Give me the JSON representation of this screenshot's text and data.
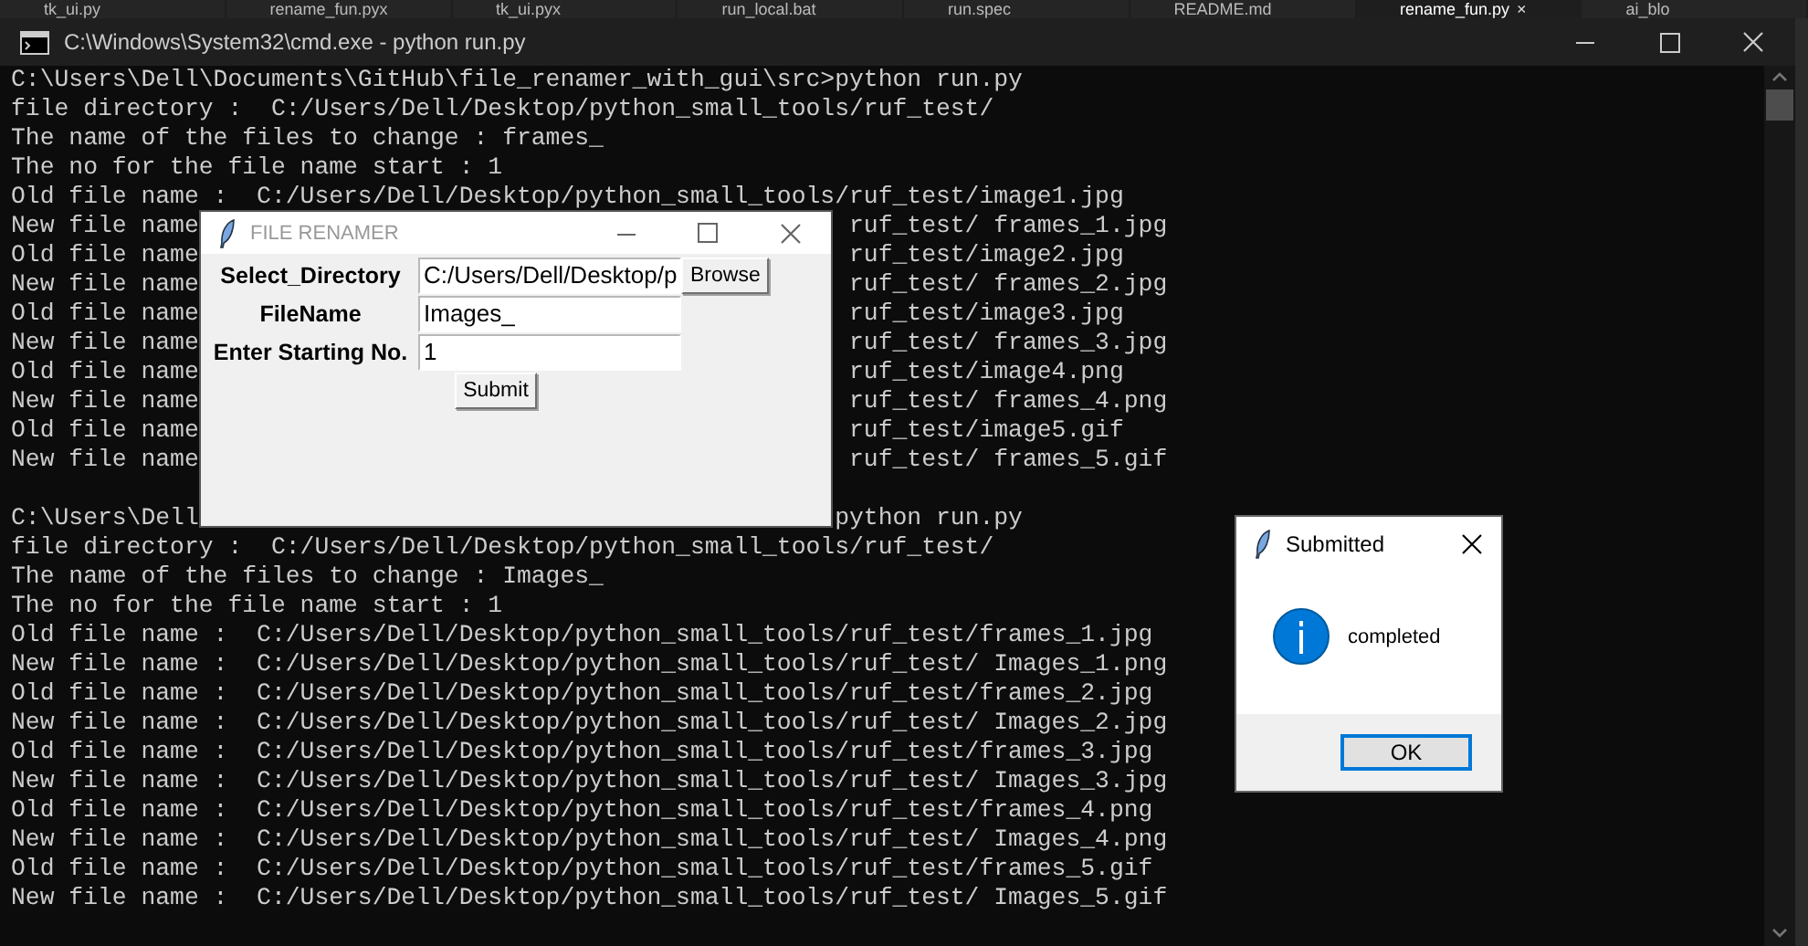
{
  "editor_tabs": [
    {
      "label": "tk_ui.py",
      "selected": false
    },
    {
      "label": "rename_fun.pyx",
      "selected": false
    },
    {
      "label": "tk_ui.pyx",
      "selected": false
    },
    {
      "label": "run_local.bat",
      "selected": false
    },
    {
      "label": "run.spec",
      "selected": false
    },
    {
      "label": "README.md",
      "selected": false
    },
    {
      "label": "rename_fun.py",
      "selected": true,
      "close": "×"
    },
    {
      "label": "ai_blo",
      "selected": false
    }
  ],
  "console": {
    "title": "C:\\Windows\\System32\\cmd.exe - python  run.py",
    "lines": [
      {
        "kind": "full",
        "text": "C:\\Users\\Dell\\Documents\\GitHub\\file_renamer_with_gui\\src>python run.py"
      },
      {
        "kind": "full",
        "text": "file directory :  C:/Users/Dell/Desktop/python_small_tools/ruf_test/"
      },
      {
        "kind": "full",
        "text": "The name of the files to change : frames_"
      },
      {
        "kind": "full",
        "text": "The no for the file name start : 1"
      },
      {
        "kind": "full",
        "text": "Old file name :  C:/Users/Dell/Desktop/python_small_tools/ruf_test/image1.jpg"
      },
      {
        "kind": "split",
        "left": "New file name",
        "right": "ruf_test/ frames_1.jpg"
      },
      {
        "kind": "split",
        "left": "Old file name",
        "right": "ruf_test/image2.jpg"
      },
      {
        "kind": "split",
        "left": "New file name",
        "right": "ruf_test/ frames_2.jpg"
      },
      {
        "kind": "split",
        "left": "Old file name",
        "right": "ruf_test/image3.jpg"
      },
      {
        "kind": "split",
        "left": "New file name",
        "right": "ruf_test/ frames_3.jpg"
      },
      {
        "kind": "split",
        "left": "Old file name",
        "right": "ruf_test/image4.png"
      },
      {
        "kind": "split",
        "left": "New file name",
        "right": "ruf_test/ frames_4.png"
      },
      {
        "kind": "split",
        "left": "Old file name",
        "right": "ruf_test/image5.gif"
      },
      {
        "kind": "split",
        "left": "New file name",
        "right": "ruf_test/ frames_5.gif"
      },
      {
        "kind": "blank"
      },
      {
        "kind": "split",
        "left": "C:\\Users\\Dell",
        "right": "python run.py"
      },
      {
        "kind": "full",
        "text": "file directory :  C:/Users/Dell/Desktop/python_small_tools/ruf_test/"
      },
      {
        "kind": "full",
        "text": "The name of the files to change : Images_"
      },
      {
        "kind": "full",
        "text": "The no for the file name start : 1"
      },
      {
        "kind": "full",
        "text": "Old file name :  C:/Users/Dell/Desktop/python_small_tools/ruf_test/frames_1.jpg"
      },
      {
        "kind": "full",
        "text": "New file name :  C:/Users/Dell/Desktop/python_small_tools/ruf_test/ Images_1.png"
      },
      {
        "kind": "full",
        "text": "Old file name :  C:/Users/Dell/Desktop/python_small_tools/ruf_test/frames_2.jpg"
      },
      {
        "kind": "full",
        "text": "New file name :  C:/Users/Dell/Desktop/python_small_tools/ruf_test/ Images_2.jpg"
      },
      {
        "kind": "full",
        "text": "Old file name :  C:/Users/Dell/Desktop/python_small_tools/ruf_test/frames_3.jpg"
      },
      {
        "kind": "full",
        "text": "New file name :  C:/Users/Dell/Desktop/python_small_tools/ruf_test/ Images_3.jpg"
      },
      {
        "kind": "full",
        "text": "Old file name :  C:/Users/Dell/Desktop/python_small_tools/ruf_test/frames_4.png"
      },
      {
        "kind": "full",
        "text": "New file name :  C:/Users/Dell/Desktop/python_small_tools/ruf_test/ Images_4.png"
      },
      {
        "kind": "full",
        "text": "Old file name :  C:/Users/Dell/Desktop/python_small_tools/ruf_test/frames_5.gif"
      },
      {
        "kind": "full",
        "text": "New file name :  C:/Users/Dell/Desktop/python_small_tools/ruf_test/ Images_5.gif"
      }
    ]
  },
  "renamer": {
    "title": "FILE RENAMER",
    "fields": [
      {
        "label": "Select_Directory",
        "value": "C:/Users/Dell/Desktop/p",
        "button": "Browse"
      },
      {
        "label": "FileName",
        "value": "Images_"
      },
      {
        "label": "Enter Starting No.",
        "value": "1"
      }
    ],
    "submit": "Submit"
  },
  "message": {
    "title": "Submitted",
    "text": "completed",
    "ok": "OK"
  }
}
